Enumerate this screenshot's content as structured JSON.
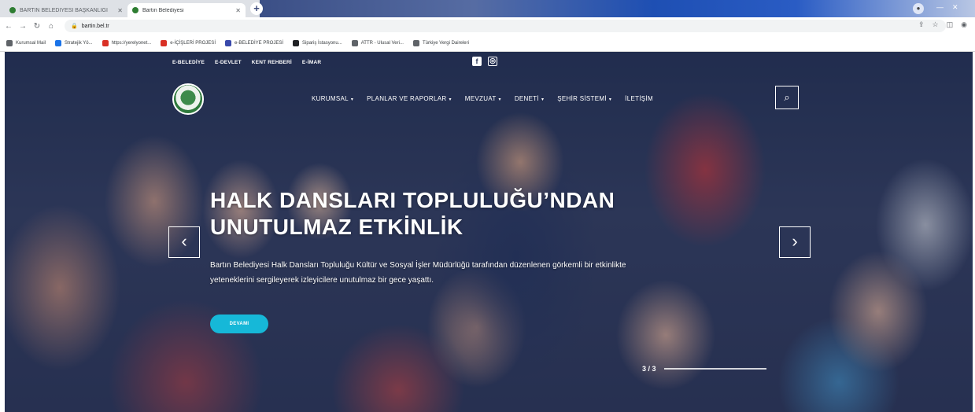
{
  "browser": {
    "tabs": [
      {
        "title": "BARTIN BELEDİYESİ BAŞKANLIĞI",
        "active": false
      },
      {
        "title": "Bartın Belediyesi",
        "active": true
      }
    ],
    "new_tab": "+",
    "url": "bartin.bel.tr",
    "bookmarks": [
      {
        "label": "Kurumsal Mail",
        "color": "#5f6368"
      },
      {
        "label": "Stratejik Yö...",
        "color": "#1a73e8"
      },
      {
        "label": "https://yerelyonet...",
        "color": "#d93025"
      },
      {
        "label": "e-İÇİŞLERİ PROJESİ",
        "color": "#d93025"
      },
      {
        "label": "e-BELEDİYE PROJESİ",
        "color": "#3949ab"
      },
      {
        "label": "Sipariş İstasyonu...",
        "color": "#202124"
      },
      {
        "label": "ATTR - Ulusal Veri...",
        "color": "#5f6368"
      },
      {
        "label": "Türkiye Vergi Daireleri",
        "color": "#5f6368"
      }
    ]
  },
  "site": {
    "top_links": [
      "E-BELEDİYE",
      "E-DEVLET",
      "KENT REHBERİ",
      "E-İMAR"
    ],
    "social": {
      "facebook": "f",
      "instagram": "◎"
    },
    "menu": [
      {
        "label": "KURUMSAL",
        "dropdown": true
      },
      {
        "label": "PLANLAR VE RAPORLAR",
        "dropdown": true
      },
      {
        "label": "MEVZUAT",
        "dropdown": true
      },
      {
        "label": "DENETİ",
        "dropdown": true
      },
      {
        "label": "ŞEHİR SİSTEMİ",
        "dropdown": true
      },
      {
        "label": "İLETİŞİM",
        "dropdown": false
      }
    ],
    "search_icon": "⌕",
    "slide": {
      "title": "HALK DANSLARI TOPLULUĞU’NDAN UNUTULMAZ ETKİNLİK",
      "description": "Bartın Belediyesi Halk Dansları Topluluğu Kültür ve Sosyal İşler Müdürlüğü tarafından düzenlenen görkemli bir etkinlikte yeteneklerini sergileyerek izleyicilere unutulmaz bir gece yaşattı.",
      "button": "DEVAMI",
      "pager": "3 / 3"
    },
    "arrows": {
      "prev": "‹",
      "next": "›"
    }
  },
  "colors": {
    "accent_button": "#16b8d8",
    "overlay": "#121e3c"
  }
}
